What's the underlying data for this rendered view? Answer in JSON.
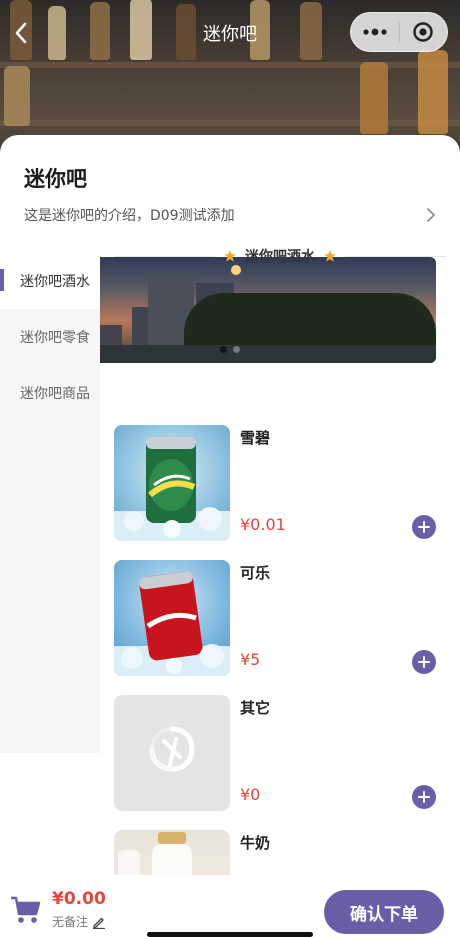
{
  "nav": {
    "title": "迷你吧"
  },
  "store": {
    "name": "迷你吧",
    "intro": "这是迷你吧的介绍，D09测试添加"
  },
  "categories": [
    {
      "label": "迷你吧酒水",
      "active": true
    },
    {
      "label": "迷你吧零食",
      "active": false
    },
    {
      "label": "迷你吧商品",
      "active": false
    }
  ],
  "section": {
    "title": "迷你吧酒水"
  },
  "products": [
    {
      "name": "雪碧",
      "price": "¥0.01",
      "image": "sprite-can"
    },
    {
      "name": "可乐",
      "price": "¥5",
      "image": "coca-cola-can"
    },
    {
      "name": "其它",
      "price": "¥0",
      "image": "placeholder-logo"
    },
    {
      "name": "牛奶",
      "price": "",
      "image": "milk-bottle"
    }
  ],
  "cart": {
    "total": "¥0.00",
    "remark": "无备注"
  },
  "actions": {
    "confirm": "确认下单"
  },
  "colors": {
    "accent": "#6a5ea8",
    "price": "#e8443a",
    "star": "#f5a623"
  },
  "icons": [
    "back-icon",
    "more-icon",
    "close-circle-icon",
    "chevron-right-icon",
    "star-icon",
    "plus-icon",
    "cart-icon",
    "edit-icon"
  ]
}
